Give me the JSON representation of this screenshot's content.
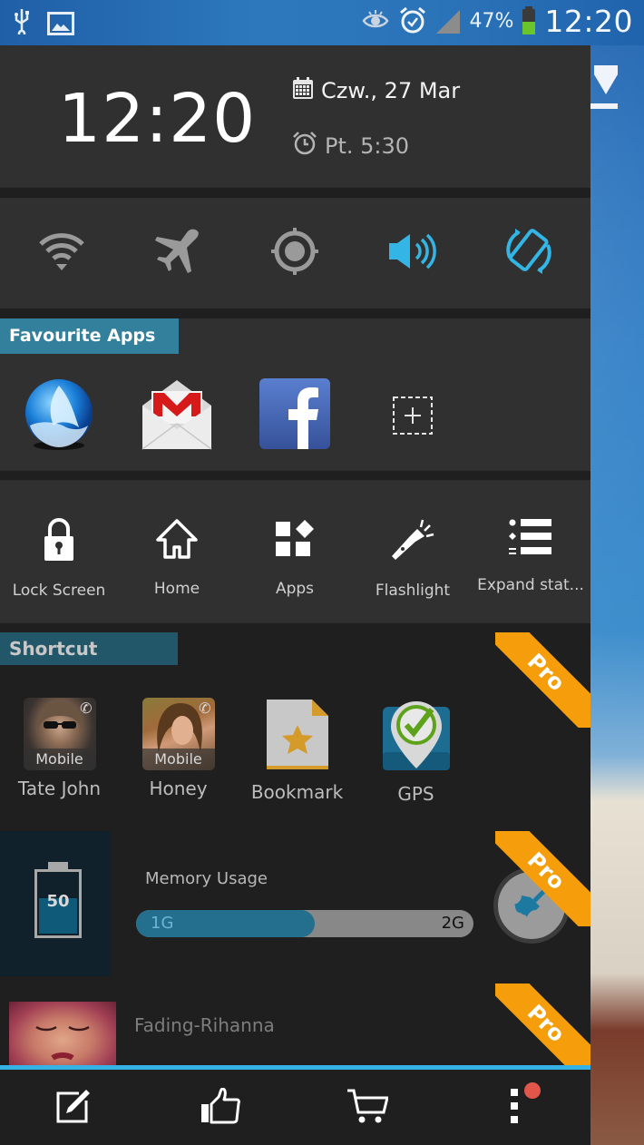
{
  "status_bar": {
    "left_icons": [
      "usb-icon",
      "image-icon"
    ],
    "right_icons": [
      "eye-icon",
      "alarm-icon",
      "signal-icon"
    ],
    "battery_percent": "47%",
    "battery_level": 0.47,
    "time": "12:20"
  },
  "clock": {
    "time": "12:20",
    "date": "Czw., 27 Mar",
    "alarm": "Pt. 5:30"
  },
  "toggles": [
    {
      "name": "wifi",
      "icon": "wifi-icon",
      "active": false
    },
    {
      "name": "airplane-mode",
      "icon": "airplane-icon",
      "active": false
    },
    {
      "name": "gps",
      "icon": "location-icon",
      "active": false
    },
    {
      "name": "sound",
      "icon": "volume-icon",
      "active": true
    },
    {
      "name": "auto-rotate",
      "icon": "rotate-icon",
      "active": true
    }
  ],
  "favourites": {
    "title": "Favourite Apps",
    "apps": [
      {
        "name": "Boat Browser",
        "icon": "boat-browser-icon"
      },
      {
        "name": "Gmail",
        "icon": "gmail-icon"
      },
      {
        "name": "Facebook",
        "icon": "facebook-icon"
      },
      {
        "name": "Add",
        "icon": "add-icon"
      }
    ]
  },
  "tools": [
    {
      "label": "Lock Screen",
      "icon": "lock-icon"
    },
    {
      "label": "Home",
      "icon": "home-icon"
    },
    {
      "label": "Apps",
      "icon": "apps-icon"
    },
    {
      "label": "Flashlight",
      "icon": "flashlight-icon"
    },
    {
      "label": "Expand stat...",
      "icon": "list-icon"
    }
  ],
  "shortcut": {
    "title": "Shortcut",
    "badge": "Pro",
    "items": [
      {
        "label": "Tate John",
        "tag": "Mobile",
        "type": "contact"
      },
      {
        "label": "Honey",
        "tag": "Mobile",
        "type": "contact"
      },
      {
        "label": "Bookmark",
        "type": "bookmark"
      },
      {
        "label": "GPS",
        "type": "gps"
      }
    ]
  },
  "memory": {
    "battery_value": "50",
    "battery_level": 0.5,
    "title": "Memory Usage",
    "used_label": "1G",
    "total_label": "2G",
    "used_fraction": 0.5,
    "badge": "Pro"
  },
  "music": {
    "track": "Fading-Rihanna",
    "badge": "Pro"
  },
  "colors": {
    "accent": "#35b1e3",
    "section_label": "#33809c",
    "pro_badge": "#f59d0a",
    "notification": "#e0564a"
  },
  "bottom_nav": [
    {
      "name": "edit",
      "icon": "edit-icon"
    },
    {
      "name": "like",
      "icon": "thumbs-up-icon"
    },
    {
      "name": "store",
      "icon": "cart-icon"
    },
    {
      "name": "more",
      "icon": "more-icon",
      "has_notification": true
    }
  ]
}
